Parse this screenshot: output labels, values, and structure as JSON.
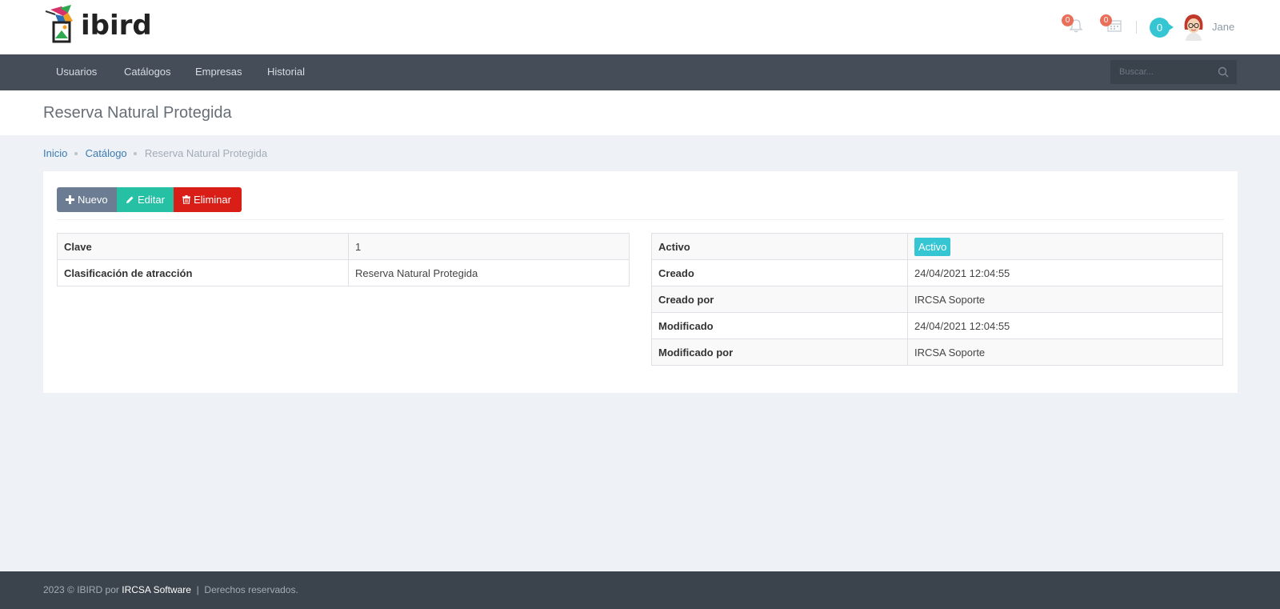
{
  "brand": {
    "name": "ibird"
  },
  "header": {
    "notifications_count": "0",
    "calendar_count": "0",
    "messages_count": "0",
    "username": "Jane"
  },
  "nav": {
    "items": [
      {
        "label": "Usuarios"
      },
      {
        "label": "Catálogos"
      },
      {
        "label": "Empresas"
      },
      {
        "label": "Historial"
      }
    ],
    "search_placeholder": "Buscar..."
  },
  "page": {
    "title": "Reserva Natural Protegida"
  },
  "breadcrumb": {
    "items": [
      {
        "label": "Inicio"
      },
      {
        "label": "Catálogo"
      },
      {
        "label": "Reserva Natural Protegida"
      }
    ]
  },
  "toolbar": {
    "new_label": "Nuevo",
    "edit_label": "Editar",
    "delete_label": "Eliminar"
  },
  "details_left": [
    {
      "key": "Clave",
      "value": "1"
    },
    {
      "key": "Clasificación de atracción",
      "value": "Reserva Natural Protegida"
    }
  ],
  "details_right": [
    {
      "key": "Activo",
      "value": "Activo"
    },
    {
      "key": "Creado",
      "value": "24/04/2021 12:04:55"
    },
    {
      "key": "Creado por",
      "value": "IRCSA Soporte"
    },
    {
      "key": "Modificado",
      "value": "24/04/2021 12:04:55"
    },
    {
      "key": "Modificado por",
      "value": "IRCSA Soporte"
    }
  ],
  "footer": {
    "prefix": "2023 © IBIRD por",
    "company": "IRCSA Software",
    "separator": "|",
    "rights": "Derechos reservados."
  },
  "colors": {
    "navbar": "#444d58",
    "accent": "#36c6d3",
    "new_button": "#6c7c93",
    "edit_button": "#26c0a5",
    "delete_button": "#d91e18",
    "badge": "#e96f5a"
  }
}
